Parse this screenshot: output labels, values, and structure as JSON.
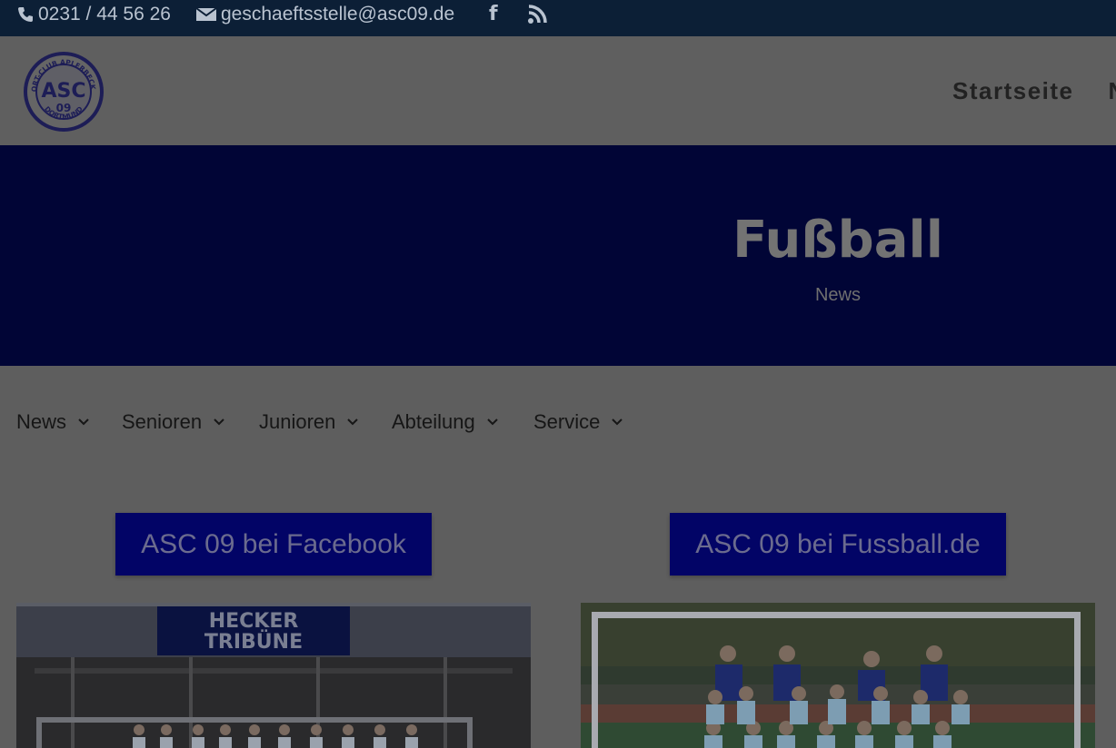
{
  "topbar": {
    "phone": "0231 / 44 56 26",
    "email": "geschaeftsstelle@asc09.de",
    "facebook_icon": "facebook-icon",
    "rss_icon": "rss-icon"
  },
  "header": {
    "logo": {
      "top_text": "SPORT-CLUB APLERBECK 09",
      "main_text": "ASC",
      "number": "09",
      "bottom_text": "DORTMUND"
    },
    "nav": [
      {
        "label": "Startseite"
      },
      {
        "label": "N"
      }
    ]
  },
  "hero": {
    "title": "Fußball",
    "subtitle": "News"
  },
  "subnav": [
    {
      "label": "News"
    },
    {
      "label": "Senioren"
    },
    {
      "label": "Junioren"
    },
    {
      "label": "Abteilung"
    },
    {
      "label": "Service"
    }
  ],
  "buttons": {
    "facebook": "ASC 09 bei Facebook",
    "fussball_de": "ASC 09 bei Fussball.de"
  },
  "photos": {
    "left_banner_line1": "HECKER",
    "left_banner_line2": "TRIBÜNE"
  },
  "colors": {
    "topbar": "#0c1f36",
    "hero": "#010536",
    "button": "#020466",
    "overlay_background": "#5e5e5e"
  }
}
